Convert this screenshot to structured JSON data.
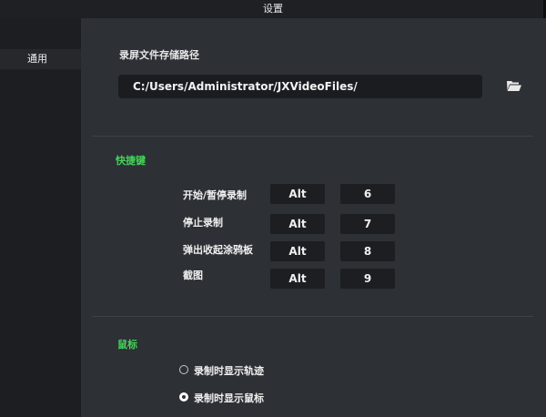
{
  "window": {
    "title": "设置"
  },
  "sidebar": {
    "items": [
      {
        "label": "通用"
      }
    ]
  },
  "storage": {
    "title": "录屏文件存储路径",
    "path": "C:/Users/Administrator/JXVideoFiles/",
    "folder_icon": "folder-open-icon"
  },
  "shortcuts": {
    "title": "快捷键",
    "items": [
      {
        "label": "开始/暂停录制",
        "modifier": "Alt",
        "key": "6"
      },
      {
        "label": "停止录制",
        "modifier": "Alt",
        "key": "7"
      },
      {
        "label": "弹出收起涂鸦板",
        "modifier": "Alt",
        "key": "8"
      },
      {
        "label": "截图",
        "modifier": "Alt",
        "key": "9"
      }
    ]
  },
  "mouse": {
    "title": "鼠标",
    "options": [
      {
        "label": "录制时显示轨迹",
        "checked": false
      },
      {
        "label": "录制时显示鼠标",
        "checked": true
      }
    ]
  },
  "colors": {
    "accent_green": "#45d35a",
    "background": "#2d3035",
    "sidebar": "#1c1e22"
  }
}
